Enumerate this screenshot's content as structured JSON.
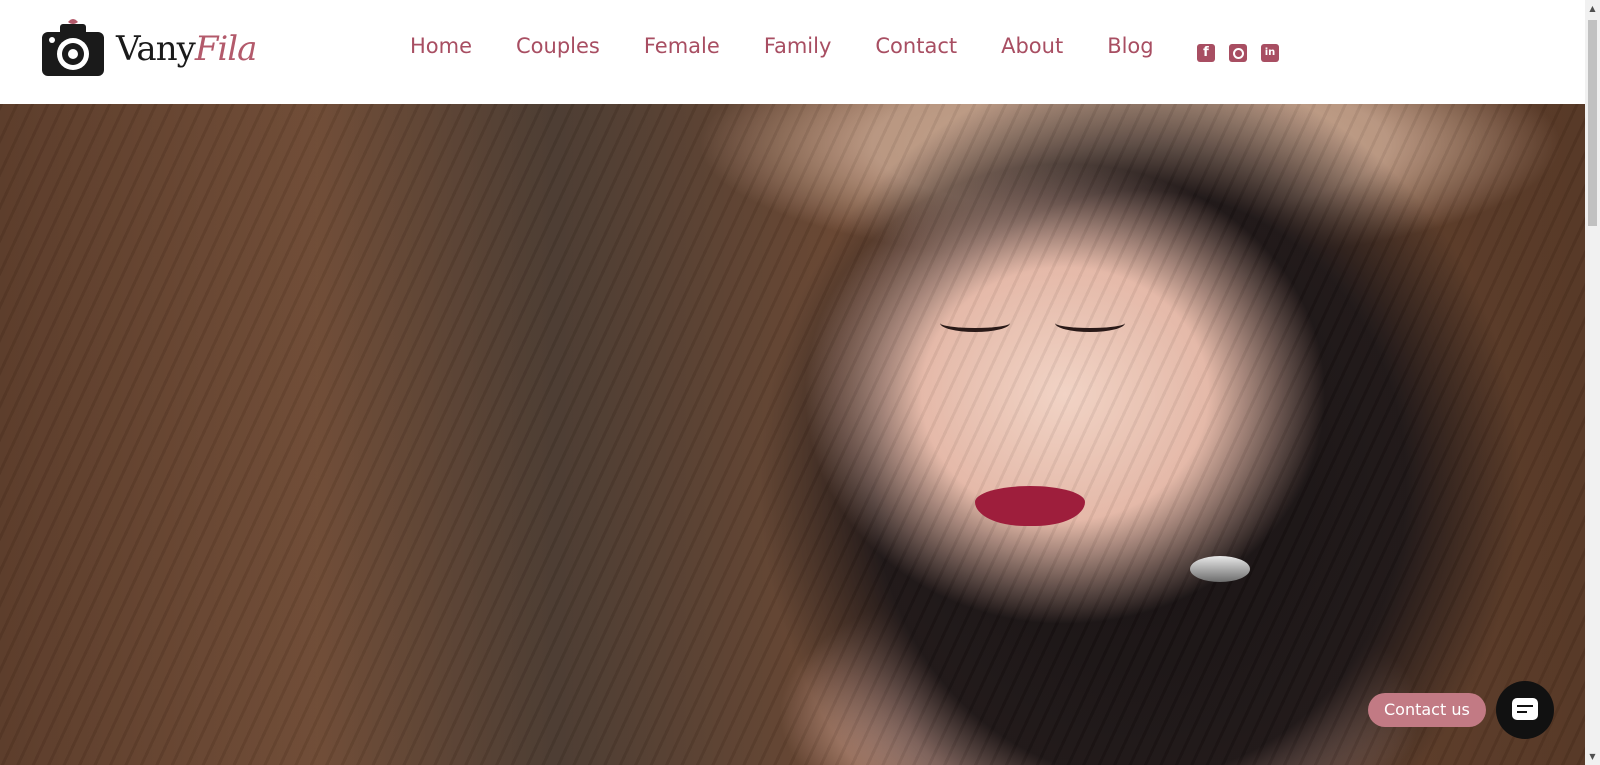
{
  "brand": {
    "name_first": "Vany",
    "name_second": "Fila",
    "logo_icon": "camera-ornament-icon"
  },
  "nav": {
    "items": [
      {
        "label": "Home"
      },
      {
        "label": "Couples"
      },
      {
        "label": "Female"
      },
      {
        "label": "Family"
      },
      {
        "label": "Contact"
      },
      {
        "label": "About"
      },
      {
        "label": "Blog"
      }
    ]
  },
  "social": {
    "facebook": {
      "glyph": "f",
      "icon": "facebook-icon"
    },
    "instagram": {
      "icon": "instagram-icon"
    },
    "linkedin": {
      "glyph": "in",
      "icon": "linkedin-icon"
    }
  },
  "hero": {
    "image": "portrait-photo",
    "subject": "woman-in-hat"
  },
  "chat": {
    "label": "Contact us",
    "icon": "chat-icon"
  },
  "colors": {
    "accent": "#a84e62",
    "pill": "#c27a84",
    "chat_button": "#111111"
  }
}
